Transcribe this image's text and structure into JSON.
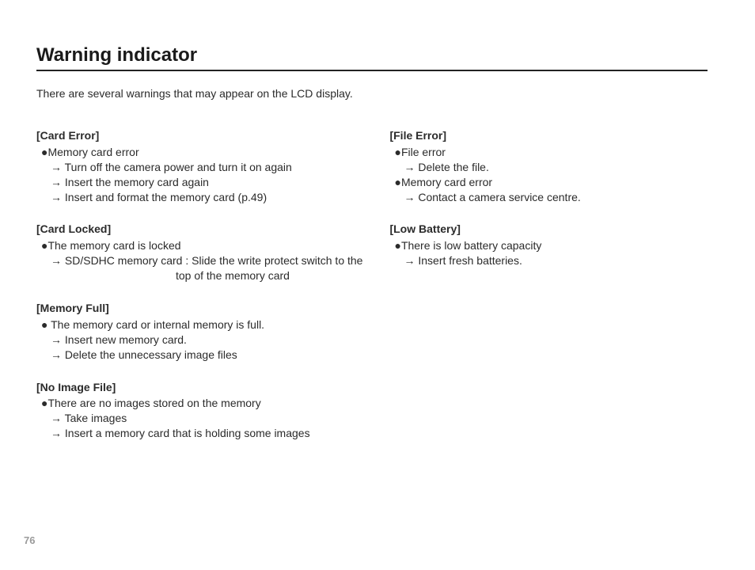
{
  "page_number": "76",
  "title": "Warning indicator",
  "intro": "There are several warnings that may appear on the LCD display.",
  "arrow": "→",
  "bullet": "●",
  "left": {
    "card_error": {
      "title": "[Card Error]",
      "cause": "Memory card error",
      "step1": "Turn off the camera power and turn it on again",
      "step2": "Insert the memory card again",
      "step3": "Insert and format the memory card (p.49)"
    },
    "card_locked": {
      "title": "[Card Locked]",
      "cause": "The memory card is locked",
      "step1": "SD/SDHC memory card : Slide the write protect switch to the",
      "step1_cont": "top of the memory card"
    },
    "memory_full": {
      "title": "[Memory Full]",
      "cause": " The memory card or internal memory is full.",
      "step1": "Insert new memory card.",
      "step2": "Delete the unnecessary image files"
    },
    "no_image": {
      "title": "[No Image File]",
      "cause": "There are no images stored on the memory",
      "step1": "Take images",
      "step2": "Insert a memory card that is holding some images"
    }
  },
  "right": {
    "file_error": {
      "title": "[File Error]",
      "cause1": "File error",
      "step1": "Delete the file.",
      "cause2": "Memory card error",
      "step2": "Contact a camera service centre."
    },
    "low_battery": {
      "title": "[Low Battery]",
      "cause": "There is low battery capacity",
      "step1": "Insert fresh batteries."
    }
  }
}
